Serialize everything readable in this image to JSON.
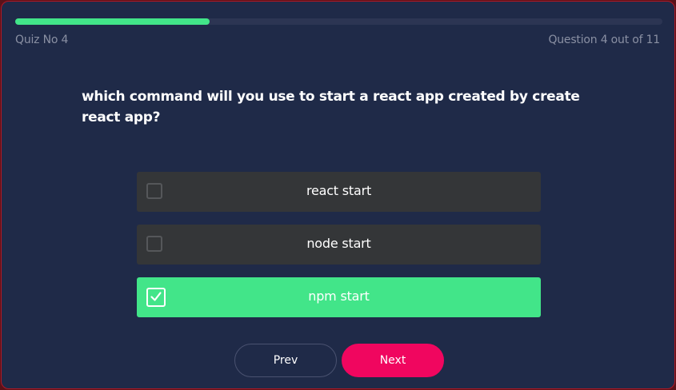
{
  "quiz": {
    "title": "Quiz No 4",
    "counter": "Question 4 out of 11",
    "progress_fraction": 0.3,
    "progress_color": "#42e589"
  },
  "question": {
    "text": "which command will you use to start a react app created by create react app?"
  },
  "options": [
    {
      "label": "react start",
      "selected": false
    },
    {
      "label": "node start",
      "selected": false
    },
    {
      "label": "npm start",
      "selected": true
    }
  ],
  "nav": {
    "prev_label": "Prev",
    "next_label": "Next",
    "next_color": "#f0065f"
  },
  "colors": {
    "background": "#1f2a48",
    "option_default": "#343638",
    "option_selected": "#42e589"
  }
}
